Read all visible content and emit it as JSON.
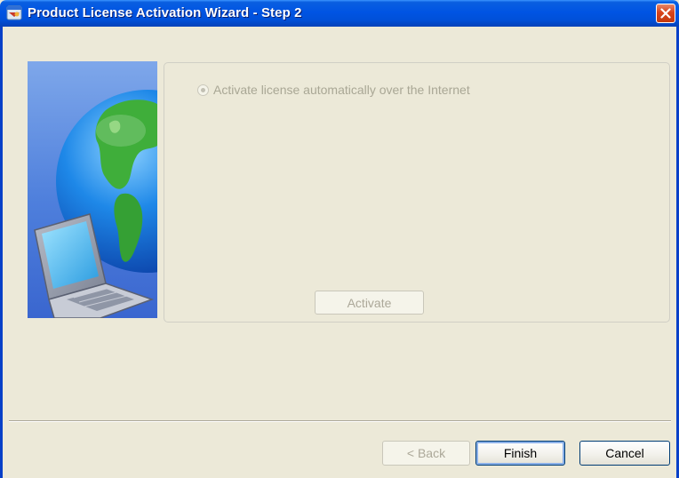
{
  "window": {
    "title": "Product License Activation Wizard - Step 2"
  },
  "icons": {
    "title": "wizard-window-icon",
    "close": "close-icon",
    "illustration": "globe-laptop-illustration"
  },
  "options": {
    "auto_activate": {
      "label": "Activate license automatically over the Internet",
      "selected": true,
      "enabled": false
    }
  },
  "buttons": {
    "activate": "Activate",
    "back": "< Back",
    "finish": "Finish",
    "cancel": "Cancel"
  },
  "colors": {
    "titlebar": "#0054e3",
    "dialog_bg": "#ece9d8",
    "close_button": "#d8431b",
    "disabled_text": "#aca899"
  }
}
